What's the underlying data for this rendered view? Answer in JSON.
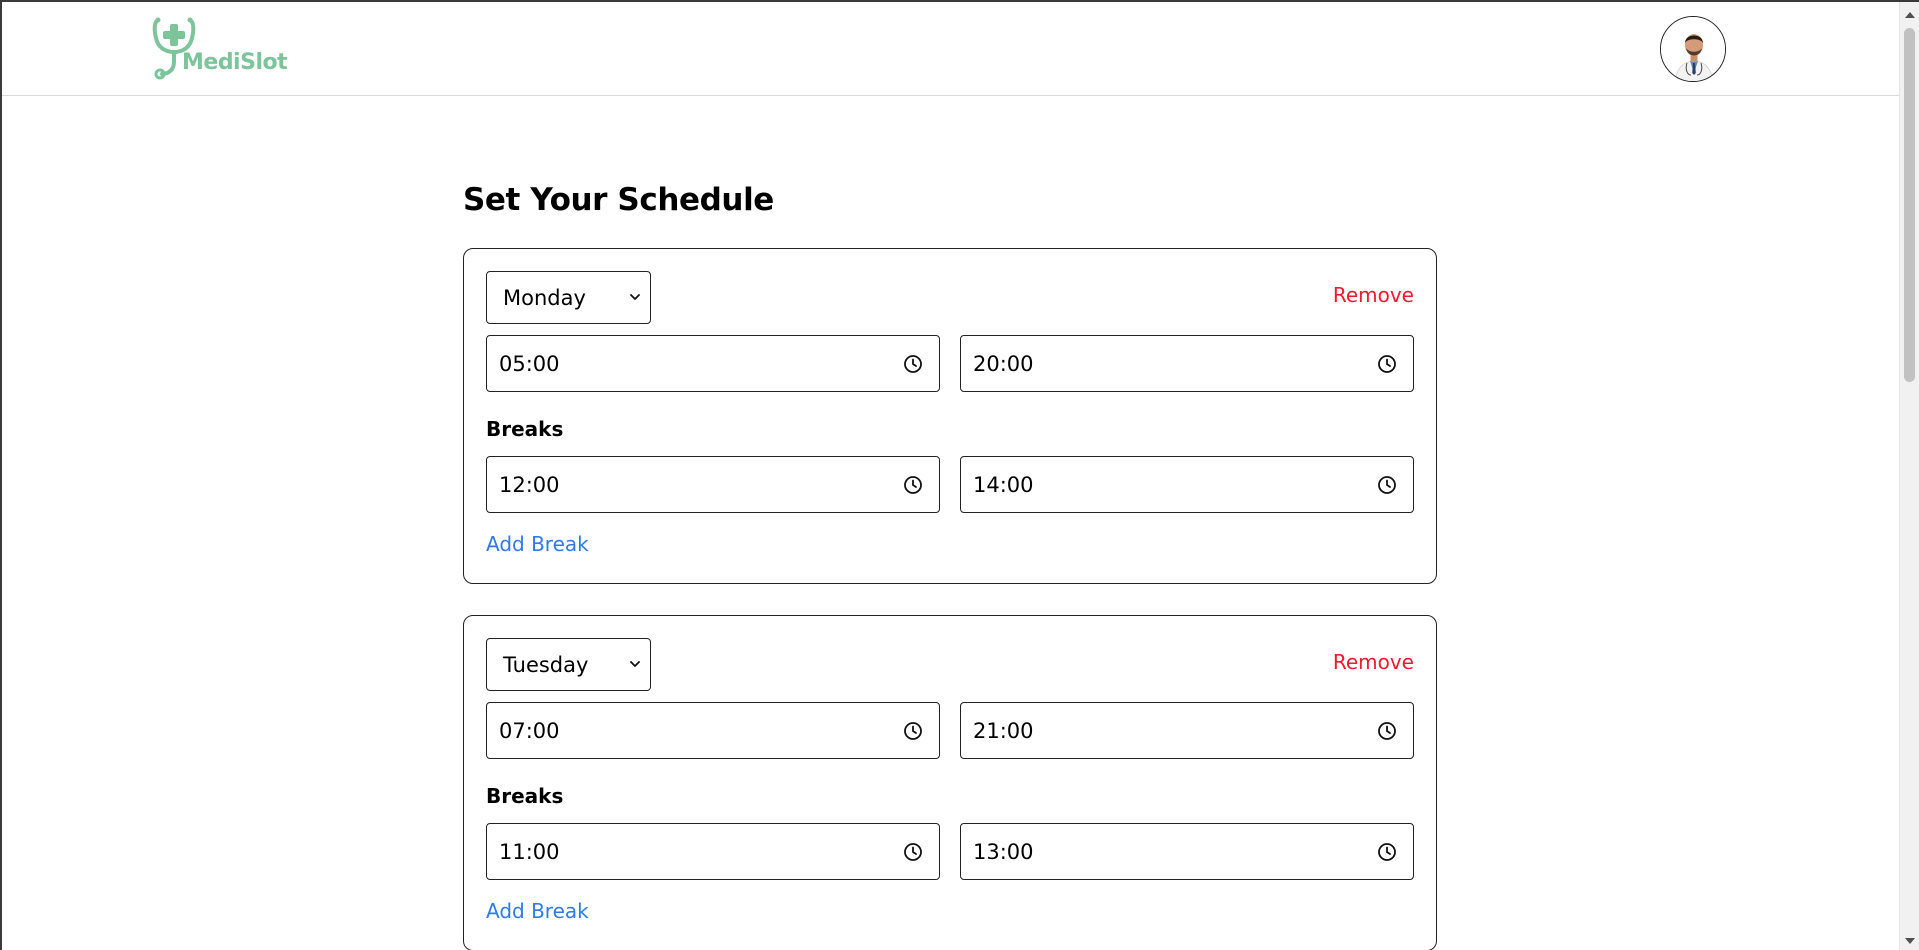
{
  "header": {
    "brand_name": "MediSlot",
    "brand_color": "#7cc49a",
    "logo_icon": "stethoscope-cross-icon",
    "avatar_icon": "doctor-avatar"
  },
  "page": {
    "title": "Set Your Schedule"
  },
  "schedule": [
    {
      "day": "Monday",
      "remove_label": "Remove",
      "start_time": "05:00",
      "end_time": "20:00",
      "breaks_label": "Breaks",
      "breaks": [
        {
          "start": "12:00",
          "end": "14:00"
        }
      ],
      "add_break_label": "Add Break"
    },
    {
      "day": "Tuesday",
      "remove_label": "Remove",
      "start_time": "07:00",
      "end_time": "21:00",
      "breaks_label": "Breaks",
      "breaks": [
        {
          "start": "11:00",
          "end": "13:00"
        }
      ],
      "add_break_label": "Add Break"
    }
  ],
  "colors": {
    "remove": "#ee1b30",
    "link": "#2f7ae5"
  }
}
